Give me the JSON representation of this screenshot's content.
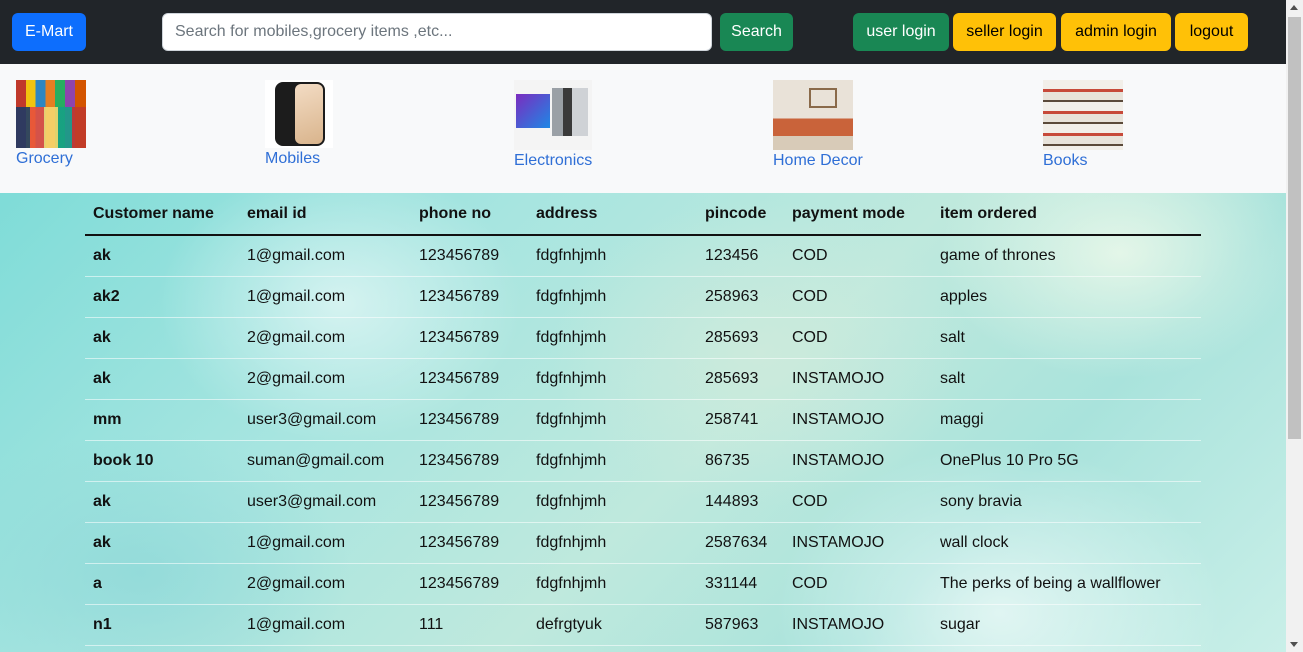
{
  "navbar": {
    "brand": "E-Mart",
    "search_placeholder": "Search for mobiles,grocery items ,etc...",
    "search_button": "Search",
    "buttons": {
      "user_login": "user login",
      "seller_login": "seller login",
      "admin_login": "admin login",
      "logout": "logout"
    }
  },
  "categories": [
    {
      "label": "Grocery"
    },
    {
      "label": "Mobiles"
    },
    {
      "label": "Electronics"
    },
    {
      "label": "Home Decor"
    },
    {
      "label": "Books"
    }
  ],
  "table": {
    "headers": [
      "Customer name",
      "email id",
      "phone no",
      "address",
      "pincode",
      "payment mode",
      "item ordered"
    ],
    "rows": [
      [
        "ak",
        "1@gmail.com",
        "123456789",
        "fdgfnhjmh",
        "123456",
        "COD",
        "game of thrones"
      ],
      [
        "ak2",
        "1@gmail.com",
        "123456789",
        "fdgfnhjmh",
        "258963",
        "COD",
        "apples"
      ],
      [
        "ak",
        "2@gmail.com",
        "123456789",
        "fdgfnhjmh",
        "285693",
        "COD",
        "salt"
      ],
      [
        "ak",
        "2@gmail.com",
        "123456789",
        "fdgfnhjmh",
        "285693",
        "INSTAMOJO",
        "salt"
      ],
      [
        "mm",
        "user3@gmail.com",
        "123456789",
        "fdgfnhjmh",
        "258741",
        "INSTAMOJO",
        "maggi"
      ],
      [
        "book 10",
        "suman@gmail.com",
        "123456789",
        "fdgfnhjmh",
        "86735",
        "INSTAMOJO",
        "OnePlus 10 Pro 5G"
      ],
      [
        "ak",
        "user3@gmail.com",
        "123456789",
        "fdgfnhjmh",
        "144893",
        "COD",
        "sony bravia"
      ],
      [
        "ak",
        "1@gmail.com",
        "123456789",
        "fdgfnhjmh",
        "2587634",
        "INSTAMOJO",
        "wall clock"
      ],
      [
        "a",
        "2@gmail.com",
        "123456789",
        "fdgfnhjmh",
        "331144",
        "COD",
        "The perks of being a wallflower"
      ],
      [
        "n1",
        "1@gmail.com",
        "111",
        "defrgtyuk",
        "587963",
        "INSTAMOJO",
        "sugar"
      ]
    ]
  },
  "colors": {
    "navbar_bg": "#212529",
    "primary": "#0d6efd",
    "success": "#198754",
    "warning": "#ffc107"
  }
}
